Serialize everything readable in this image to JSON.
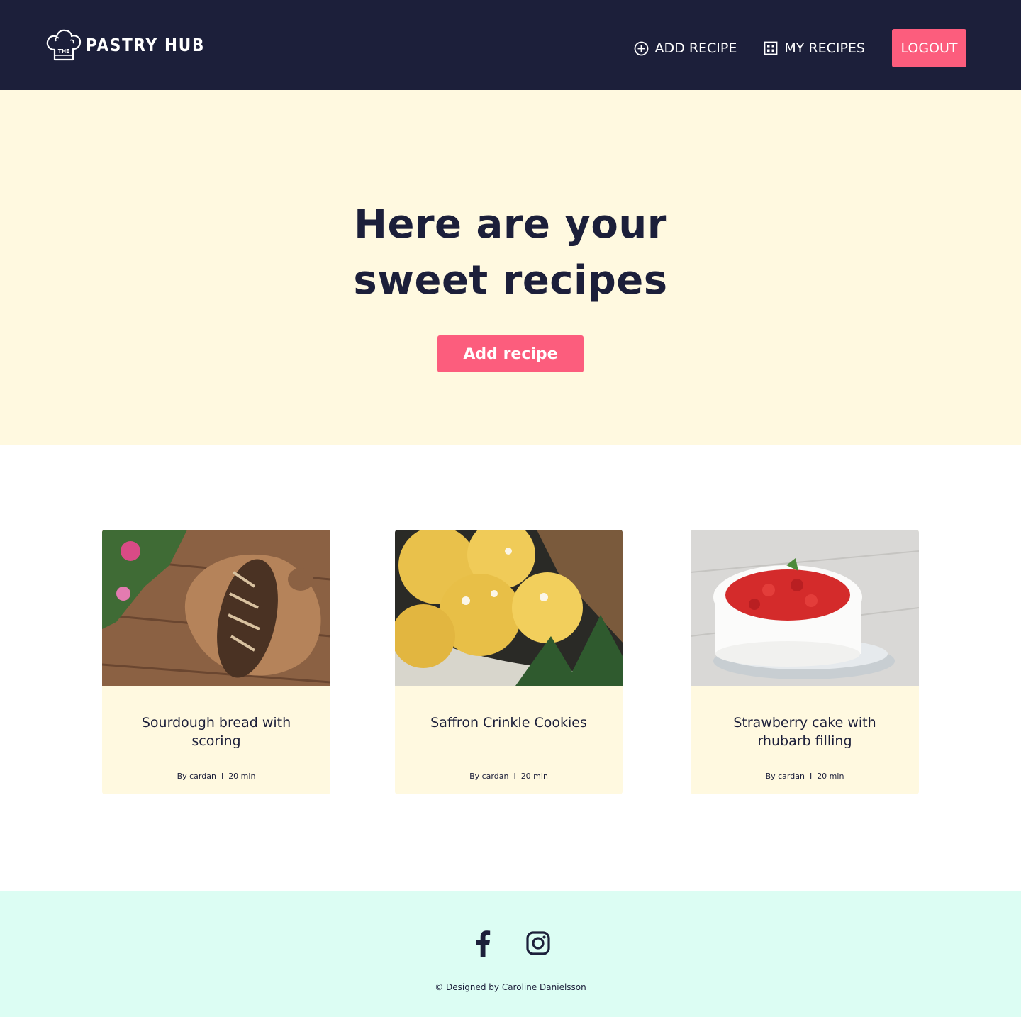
{
  "header": {
    "logo_badge": "THE",
    "logo_text": "PASTRY HUB",
    "nav": {
      "add_recipe": "ADD RECIPE",
      "my_recipes": "MY RECIPES",
      "logout": "LOGOUT"
    }
  },
  "hero": {
    "title_line1": "Here are your",
    "title_line2": "sweet recipes",
    "button": "Add recipe"
  },
  "recipes": [
    {
      "title": "Sourdough bread with scoring",
      "author": "By cardan",
      "separator": "I",
      "time": "20 min",
      "image": "sourdough-bread-photo"
    },
    {
      "title": "Saffron Crinkle Cookies",
      "author": "By cardan",
      "separator": "I",
      "time": "20 min",
      "image": "saffron-cookies-photo"
    },
    {
      "title": "Strawberry cake with rhubarb filling",
      "author": "By cardan",
      "separator": "I",
      "time": "20 min",
      "image": "strawberry-cake-photo"
    }
  ],
  "footer": {
    "copyright": "© Designed by Caroline Danielsson",
    "icons": [
      "facebook-icon",
      "instagram-icon"
    ]
  },
  "colors": {
    "navy": "#1c1f3a",
    "pink": "#fc5d7d",
    "cream": "#fff9e0",
    "mint": "#dcfdf3"
  }
}
